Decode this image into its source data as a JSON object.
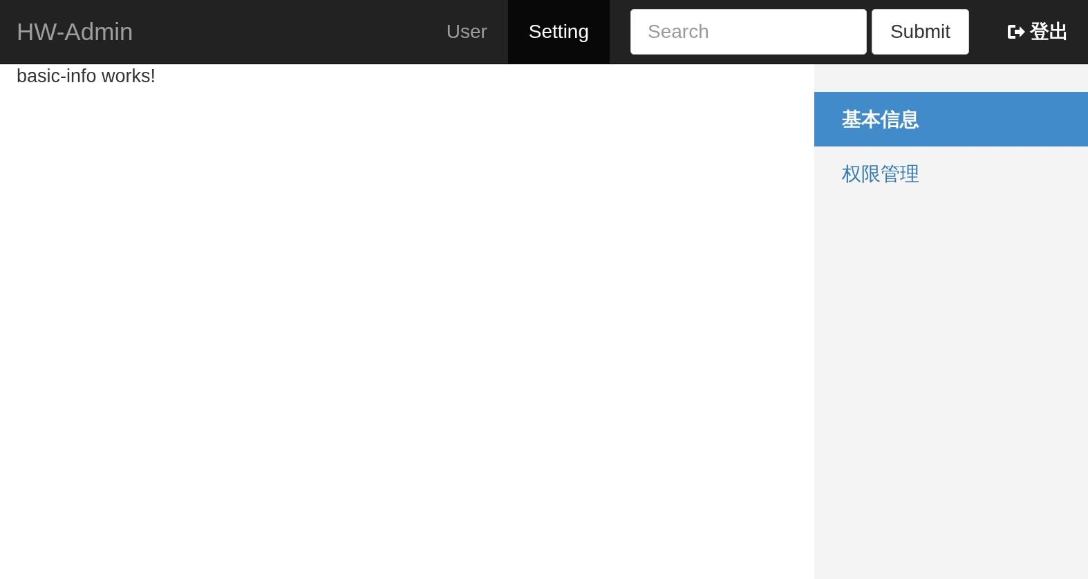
{
  "navbar": {
    "brand": "HW-Admin",
    "nav_items": [
      {
        "label": "User",
        "selected": false
      },
      {
        "label": "Setting",
        "selected": true
      }
    ],
    "search": {
      "placeholder": "Search"
    },
    "submit_button": "Submit",
    "logout": "登出"
  },
  "content": {
    "text": "basic-info works!"
  },
  "sidebar": {
    "items": [
      {
        "label": "基本信息",
        "selected": true
      },
      {
        "label": "权限管理",
        "selected": false
      }
    ]
  }
}
